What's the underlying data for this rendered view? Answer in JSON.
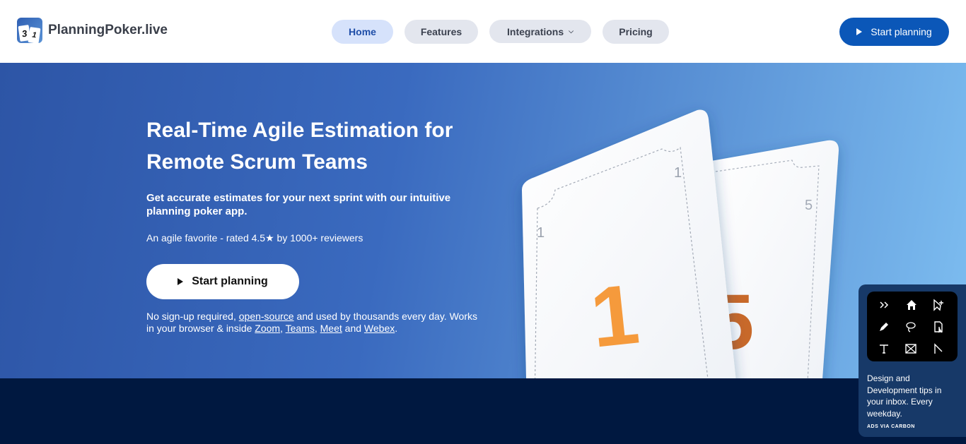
{
  "brand": {
    "name": "PlanningPoker.live",
    "logo_card_a": "3",
    "logo_card_b": "1"
  },
  "nav": {
    "items": [
      {
        "label": "Home",
        "active": true
      },
      {
        "label": "Features",
        "active": false
      },
      {
        "label": "Integrations",
        "active": false,
        "dropdown": true
      },
      {
        "label": "Pricing",
        "active": false
      }
    ],
    "cta_label": "Start planning"
  },
  "hero": {
    "title": "Real-Time Agile Estimation for Remote Scrum Teams",
    "subtitle": "Get accurate estimates for your next sprint with our intuitive planning poker app.",
    "rating": "An agile favorite - rated 4.5★ by 1000+ reviewers",
    "cta_label": "Start planning",
    "note_prefix": "No sign-up required, ",
    "note_link_open_source": "open-source",
    "note_middle": " and used by thousands every day. Works in your browser & inside ",
    "note_link_zoom": "Zoom",
    "note_sep1": ", ",
    "note_link_teams": "Teams",
    "note_sep2": ", ",
    "note_link_meet": "Meet",
    "note_and": " and ",
    "note_link_webex": "Webex",
    "note_end": ".",
    "card_front": {
      "corner": "1",
      "value": "1"
    },
    "card_back": {
      "corner": "5",
      "value": "5"
    }
  },
  "ad": {
    "text": "Design and Development tips in your inbox. Every weekday.",
    "via": "ADS VIA CARBON"
  },
  "colors": {
    "primary": "#0b57b8",
    "nav_active_bg": "#d6e2fb",
    "hero_start": "#2d55a6",
    "hero_end": "#7dbdf0",
    "card_number_orange": "#f59a3c",
    "footer_dark": "#001840"
  }
}
